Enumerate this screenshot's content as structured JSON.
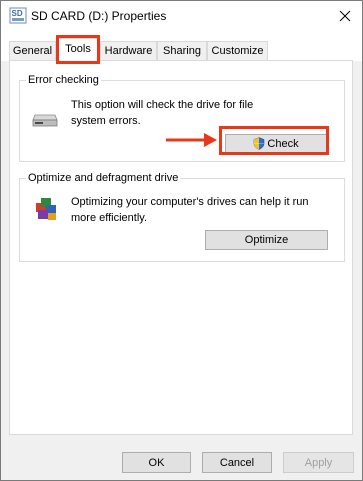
{
  "window": {
    "title": "SD CARD (D:) Properties",
    "drive_icon_label": "SD"
  },
  "tabs": [
    {
      "label": "General"
    },
    {
      "label": "Tools"
    },
    {
      "label": "Hardware"
    },
    {
      "label": "Sharing"
    },
    {
      "label": "Customize"
    }
  ],
  "active_tab": "Tools",
  "error_checking": {
    "title": "Error checking",
    "description_line1": "This option will check the drive for file",
    "description_line2": "system errors.",
    "button_label": "Check",
    "icon": "drive-icon",
    "button_icon": "uac-shield-icon"
  },
  "optimize": {
    "title": "Optimize and defragment drive",
    "description_line1": "Optimizing your computer's drives can help it run",
    "description_line2": "more efficiently.",
    "button_label": "Optimize",
    "icon": "defrag-icon"
  },
  "footer": {
    "ok_label": "OK",
    "cancel_label": "Cancel",
    "apply_label": "Apply"
  },
  "annotations": {
    "highlight_color": "#e8381a"
  }
}
